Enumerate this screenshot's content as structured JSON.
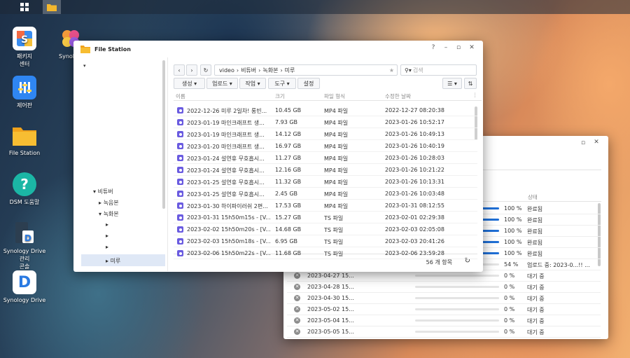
{
  "taskbar": {
    "apps": [
      "main-menu",
      "file-station"
    ]
  },
  "desktop": {
    "icons": [
      {
        "label": "패키지\n센터",
        "name": "package-center"
      },
      {
        "label": "Synol",
        "name": "synology-photos"
      },
      {
        "label": "제어판",
        "name": "control-panel"
      },
      {
        "label": "File Station",
        "name": "file-station"
      },
      {
        "label": "DSM 도움말",
        "name": "dsm-help"
      },
      {
        "label": "Synology Drive 관리\n콘솔",
        "name": "drive-admin"
      },
      {
        "label": "Synology Drive",
        "name": "synology-drive"
      }
    ]
  },
  "file_station": {
    "title": "File Station",
    "tree": {
      "root": "비튜버",
      "children": [
        "녹음본",
        "녹화본"
      ],
      "sub": [
        "",
        "",
        "",
        ""
      ],
      "selected": "미루"
    },
    "path": [
      "video",
      "비튜버",
      "녹화본",
      "미루"
    ],
    "search_placeholder": "검색",
    "toolbar": {
      "create": "생성",
      "upload": "업로드",
      "action": "작업",
      "tools": "도구",
      "settings": "설정"
    },
    "columns": [
      "이름",
      "크기",
      "파일 형식",
      "수정한 날짜"
    ],
    "rows": [
      {
        "name": "2022-12-26 미루 2일차! 롱빈...",
        "size": "10.45 GB",
        "type": "MP4 파일",
        "modified": "2022-12-27 08:20:38"
      },
      {
        "name": "2023-01-19 마인크래프트 생...",
        "size": "7.93 GB",
        "type": "MP4 파일",
        "modified": "2023-01-26 10:52:17"
      },
      {
        "name": "2023-01-19 마인크래프트 생...",
        "size": "14.12 GB",
        "type": "MP4 파일",
        "modified": "2023-01-26 10:49:13"
      },
      {
        "name": "2023-01-20 마인크래프트 생...",
        "size": "16.97 GB",
        "type": "MP4 파일",
        "modified": "2023-01-26 10:40:19"
      },
      {
        "name": "2023-01-24 설연휴 무호흡시...",
        "size": "11.27 GB",
        "type": "MP4 파일",
        "modified": "2023-01-26 10:28:03"
      },
      {
        "name": "2023-01-24 설연휴 무호흡시...",
        "size": "12.16 GB",
        "type": "MP4 파일",
        "modified": "2023-01-26 10:21:22"
      },
      {
        "name": "2023-01-25 설연휴 무호흡시...",
        "size": "11.32 GB",
        "type": "MP4 파일",
        "modified": "2023-01-26 10:13:31"
      },
      {
        "name": "2023-01-25 설연휴 무호흡시...",
        "size": "2.45 GB",
        "type": "MP4 파일",
        "modified": "2023-01-26 10:03:48"
      },
      {
        "name": "2023-01-30 하이파이러쉬 2편...",
        "size": "17.53 GB",
        "type": "MP4 파일",
        "modified": "2023-01-31 08:12:55"
      },
      {
        "name": "2023-01-31 15h50m15s - [V...",
        "size": "15.27 GB",
        "type": "TS 파일",
        "modified": "2023-02-01 02:29:38"
      },
      {
        "name": "2023-02-02 15h50m20s - [V...",
        "size": "14.68 GB",
        "type": "TS 파일",
        "modified": "2023-02-03 02:05:08"
      },
      {
        "name": "2023-02-03 15h50m18s - [V...",
        "size": "6.95 GB",
        "type": "TS 파일",
        "modified": "2023-02-03 20:41:26"
      },
      {
        "name": "2023-02-06 15h50m22s - [V...",
        "size": "11.68 GB",
        "type": "TS 파일",
        "modified": "2023-02-06 23:59:28"
      }
    ],
    "item_count": "56 개 항목"
  },
  "transfer": {
    "status_header": "상태",
    "rows": [
      {
        "name": "",
        "progress": 1.0,
        "pct": "100 %",
        "status": "완료됨",
        "icon": "none"
      },
      {
        "name": "",
        "progress": 1.0,
        "pct": "100 %",
        "status": "완료됨",
        "icon": "none"
      },
      {
        "name": "",
        "progress": 1.0,
        "pct": "100 %",
        "status": "완료됨",
        "icon": "none"
      },
      {
        "name": "",
        "progress": 1.0,
        "pct": "100 %",
        "status": "완료됨",
        "icon": "none"
      },
      {
        "name": "",
        "progress": 1.0,
        "pct": "100 %",
        "status": "완료됨",
        "icon": "none"
      },
      {
        "name": "",
        "progress": 0.54,
        "pct": "54 %",
        "status": "업로드 중: 2023-0...!! ...",
        "icon": "none"
      },
      {
        "name": "2023-04-27 15...",
        "progress": 0,
        "pct": "0 %",
        "status": "대기 중",
        "icon": "cancel"
      },
      {
        "name": "2023-04-28 15...",
        "progress": 0,
        "pct": "0 %",
        "status": "대기 중",
        "icon": "cancel"
      },
      {
        "name": "2023-04-30 15...",
        "progress": 0,
        "pct": "0 %",
        "status": "대기 중",
        "icon": "cancel"
      },
      {
        "name": "2023-05-02 15...",
        "progress": 0,
        "pct": "0 %",
        "status": "대기 중",
        "icon": "cancel"
      },
      {
        "name": "2023-05-04 15...",
        "progress": 0,
        "pct": "0 %",
        "status": "대기 중",
        "icon": "cancel"
      },
      {
        "name": "2023-05-05 15...",
        "progress": 0,
        "pct": "0 %",
        "status": "대기 중",
        "icon": "cancel"
      }
    ]
  }
}
